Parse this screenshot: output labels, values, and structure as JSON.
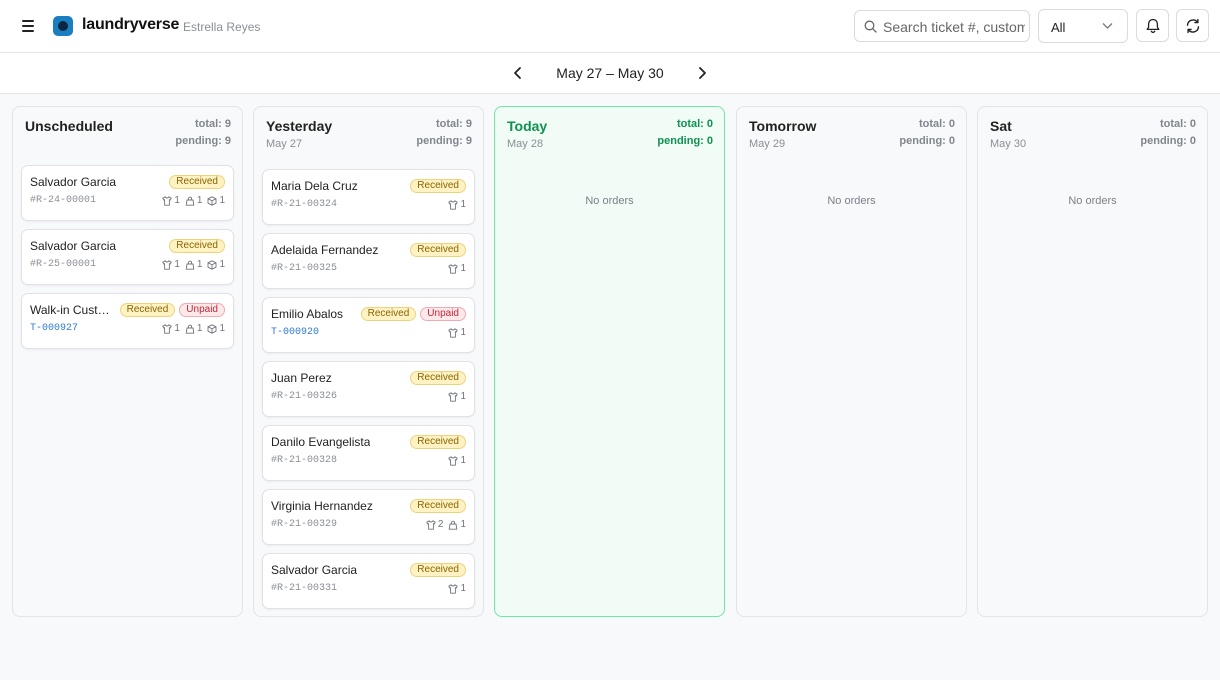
{
  "header": {
    "brand": "laundryverse",
    "user": "Estrella Reyes",
    "search_placeholder": "Search ticket #, customer",
    "filter_value": "All",
    "icons": {
      "menu": "hamburger-icon",
      "search": "search-icon",
      "chevron": "chevron-down-icon",
      "bell": "bell-icon",
      "refresh": "refresh-icon"
    }
  },
  "datenav": {
    "range": "May 27 – May 30"
  },
  "colors": {
    "accent_today": "#0f9150",
    "today_border": "#6ee7a9",
    "link": "#2f7ad8"
  },
  "columns": [
    {
      "title": "Unscheduled",
      "date": "",
      "total": "total: 9",
      "pending": "pending: 9",
      "empty": "",
      "cards": [
        {
          "name": "Salvador Garcia",
          "badges": [
            "Received"
          ],
          "ticket": "#R-24-00001",
          "link": false,
          "items": [
            [
              "shirt",
              "1"
            ],
            [
              "bag",
              "1"
            ],
            [
              "box",
              "1"
            ]
          ]
        },
        {
          "name": "Salvador Garcia",
          "badges": [
            "Received"
          ],
          "ticket": "#R-25-00001",
          "link": false,
          "items": [
            [
              "shirt",
              "1"
            ],
            [
              "bag",
              "1"
            ],
            [
              "box",
              "1"
            ]
          ]
        },
        {
          "name": "Walk-in Customer",
          "badges": [
            "Received",
            "Unpaid"
          ],
          "ticket": "T-000927",
          "link": true,
          "items": [
            [
              "shirt",
              "1"
            ],
            [
              "bag",
              "1"
            ],
            [
              "box",
              "1"
            ]
          ]
        }
      ]
    },
    {
      "title": "Yesterday",
      "date": "May 27",
      "total": "total: 9",
      "pending": "pending: 9",
      "empty": "",
      "cards": [
        {
          "name": "Maria Dela Cruz",
          "badges": [
            "Received"
          ],
          "ticket": "#R-21-00324",
          "link": false,
          "items": [
            [
              "shirt",
              "1"
            ]
          ]
        },
        {
          "name": "Adelaida Fernandez",
          "badges": [
            "Received"
          ],
          "ticket": "#R-21-00325",
          "link": false,
          "items": [
            [
              "shirt",
              "1"
            ]
          ]
        },
        {
          "name": "Emilio Abalos",
          "badges": [
            "Received",
            "Unpaid"
          ],
          "ticket": "T-000920",
          "link": true,
          "items": [
            [
              "shirt",
              "1"
            ]
          ]
        },
        {
          "name": "Juan Perez",
          "badges": [
            "Received"
          ],
          "ticket": "#R-21-00326",
          "link": false,
          "items": [
            [
              "shirt",
              "1"
            ]
          ]
        },
        {
          "name": "Danilo Evangelista",
          "badges": [
            "Received"
          ],
          "ticket": "#R-21-00328",
          "link": false,
          "items": [
            [
              "shirt",
              "1"
            ]
          ]
        },
        {
          "name": "Virginia Hernandez",
          "badges": [
            "Received"
          ],
          "ticket": "#R-21-00329",
          "link": false,
          "items": [
            [
              "shirt",
              "2"
            ],
            [
              "bag",
              "1"
            ]
          ]
        },
        {
          "name": "Salvador Garcia",
          "badges": [
            "Received"
          ],
          "ticket": "#R-21-00331",
          "link": false,
          "items": [
            [
              "shirt",
              "1"
            ]
          ]
        }
      ]
    },
    {
      "title": "Today",
      "date": "May 28",
      "total": "total: 0",
      "pending": "pending: 0",
      "empty": "No orders",
      "cards": []
    },
    {
      "title": "Tomorrow",
      "date": "May 29",
      "total": "total: 0",
      "pending": "pending: 0",
      "empty": "No orders",
      "cards": []
    },
    {
      "title": "Sat",
      "date": "May 30",
      "total": "total: 0",
      "pending": "pending: 0",
      "empty": "No orders",
      "cards": []
    }
  ]
}
